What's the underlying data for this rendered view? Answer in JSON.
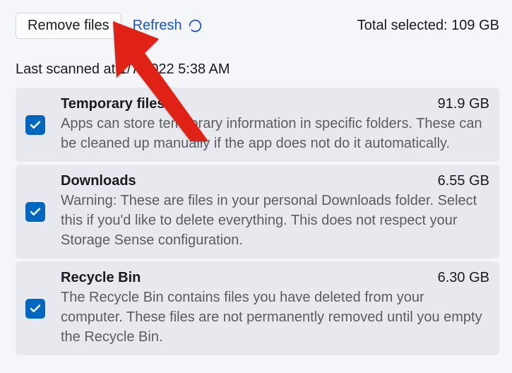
{
  "toolbar": {
    "remove_label": "Remove files",
    "refresh_label": "Refresh",
    "total_label": "Total selected: 109 GB"
  },
  "scan_time": "Last scanned at 1/7/2022 5:38 AM",
  "items": [
    {
      "title": "Temporary files",
      "size": "91.9 GB",
      "desc": "Apps can store temporary information in specific folders. These can be cleaned up manually if the app does not do it automatically.",
      "checked": true
    },
    {
      "title": "Downloads",
      "size": "6.55 GB",
      "desc": "Warning: These are files in your personal Downloads folder. Select this if you'd like to delete everything. This does not respect your Storage Sense configuration.",
      "checked": true
    },
    {
      "title": "Recycle Bin",
      "size": "6.30 GB",
      "desc": "The Recycle Bin contains files you have deleted from your computer. These files are not permanently removed until you empty the Recycle Bin.",
      "checked": true
    }
  ]
}
